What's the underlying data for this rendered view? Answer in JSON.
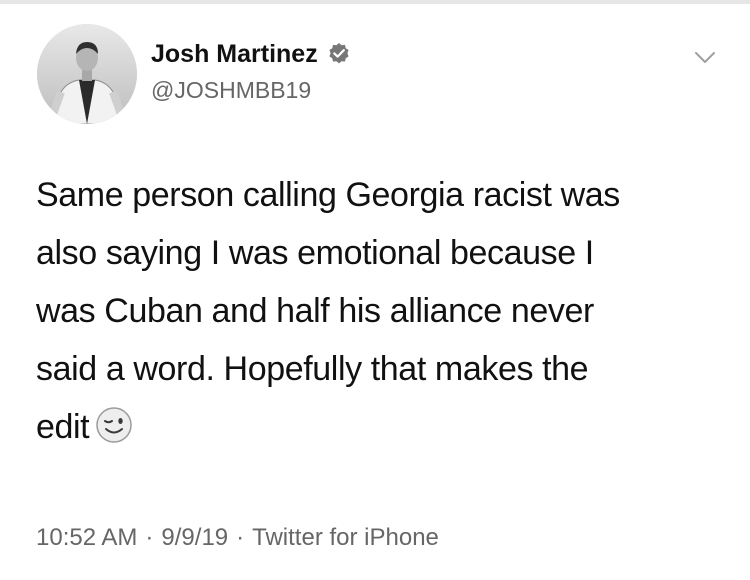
{
  "author": {
    "display_name": "Josh Martinez",
    "handle": "@JOSHMBB19",
    "verified": true
  },
  "tweet": {
    "lines": [
      "Same person calling Georgia racist was",
      "also saying I was emotional because I",
      "was Cuban and half his alliance never",
      "said a word. Hopefully that makes the",
      "edit"
    ],
    "trailing_emoji": "winking-face"
  },
  "meta": {
    "time": "10:52 AM",
    "separator": "·",
    "date": "9/9/19",
    "source": "Twitter for iPhone"
  },
  "icons": {
    "verified": "verified-badge-icon",
    "menu": "chevron-down-icon",
    "emoji": "wink-emoji-icon"
  },
  "colors": {
    "text": "#111111",
    "secondary": "#666666",
    "badge": "#777777"
  }
}
